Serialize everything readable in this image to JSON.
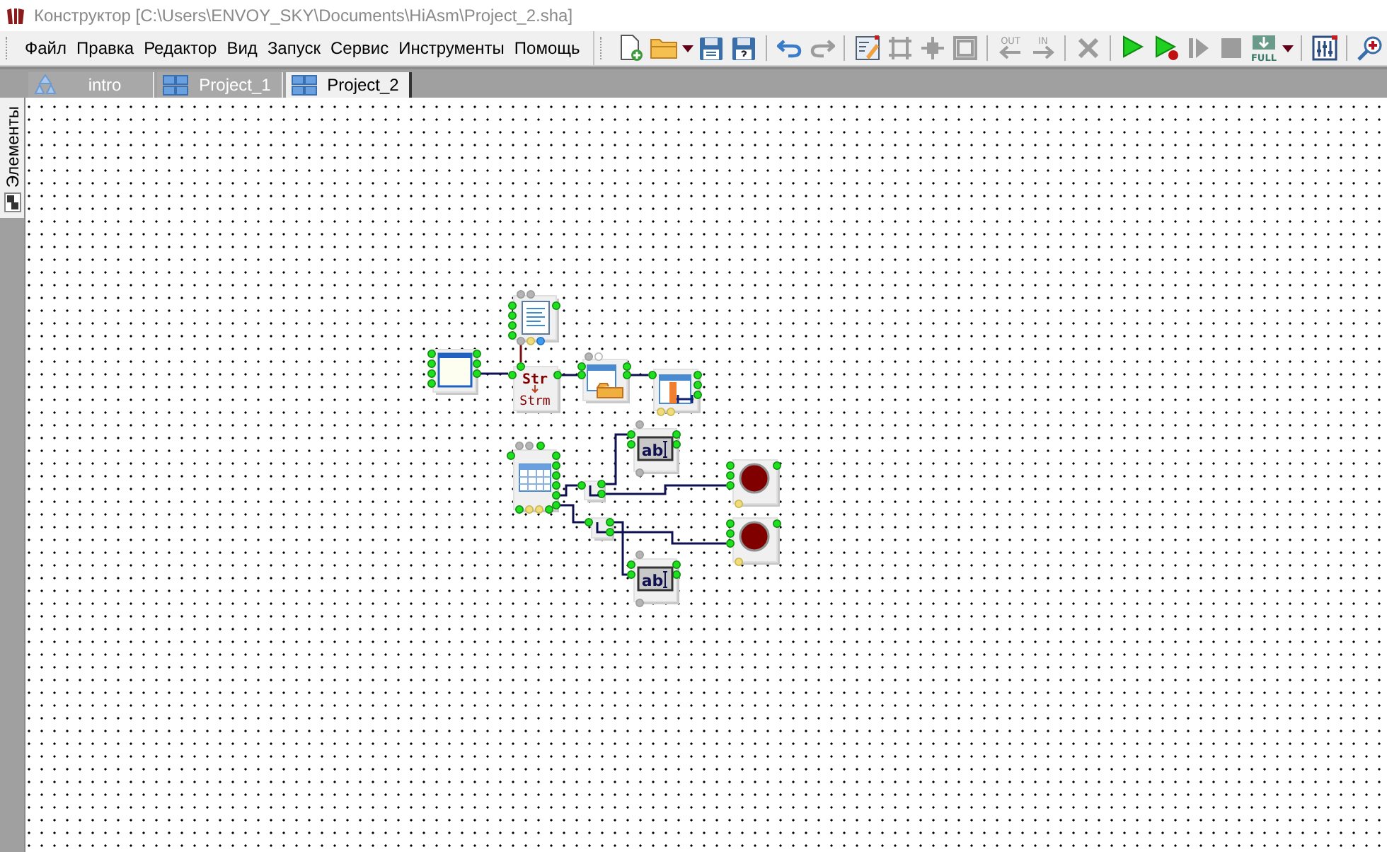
{
  "window": {
    "title": "Конструктор [C:\\Users\\ENVOY_SKY\\Documents\\HiAsm\\Project_2.sha]"
  },
  "menu": [
    "Файл",
    "Правка",
    "Редактор",
    "Вид",
    "Запуск",
    "Сервис",
    "Инструменты",
    "Помощь"
  ],
  "toolbar": [
    {
      "kind": "new",
      "disabled": false
    },
    {
      "kind": "open",
      "disabled": false
    },
    {
      "kind": "caret",
      "disabled": false
    },
    {
      "kind": "save",
      "disabled": false
    },
    {
      "kind": "save-as",
      "disabled": false
    },
    {
      "kind": "sep"
    },
    {
      "kind": "undo",
      "disabled": false
    },
    {
      "kind": "redo",
      "disabled": true
    },
    {
      "kind": "sep"
    },
    {
      "kind": "edit",
      "disabled": false
    },
    {
      "kind": "frame",
      "disabled": true
    },
    {
      "kind": "cross",
      "disabled": true
    },
    {
      "kind": "square",
      "disabled": true
    },
    {
      "kind": "sep"
    },
    {
      "kind": "out",
      "label": "OUT",
      "disabled": true
    },
    {
      "kind": "in",
      "label": "IN",
      "disabled": true
    },
    {
      "kind": "sep"
    },
    {
      "kind": "delete",
      "disabled": true
    },
    {
      "kind": "sep"
    },
    {
      "kind": "run",
      "disabled": false
    },
    {
      "kind": "run-debug",
      "disabled": false
    },
    {
      "kind": "step",
      "disabled": true
    },
    {
      "kind": "stop",
      "disabled": true
    },
    {
      "kind": "full",
      "label": "FULL",
      "disabled": false
    },
    {
      "kind": "caret",
      "disabled": false
    },
    {
      "kind": "sep"
    },
    {
      "kind": "mixer",
      "disabled": false
    },
    {
      "kind": "sep"
    },
    {
      "kind": "zoom",
      "disabled": false
    }
  ],
  "tabs": [
    {
      "label": "intro",
      "kind": "intro",
      "selected": false
    },
    {
      "label": "Project_1",
      "kind": "project",
      "selected": false
    },
    {
      "label": "Project_2",
      "kind": "project",
      "selected": true
    }
  ],
  "side_panel": {
    "label": "Элементы"
  },
  "diagram": {
    "nodes": [
      {
        "kind": "form"
      },
      {
        "kind": "memo"
      },
      {
        "kind": "str-to-stream",
        "labels": [
          "Str",
          "Strm"
        ]
      },
      {
        "kind": "open-dialog"
      },
      {
        "kind": "table-list"
      },
      {
        "kind": "grid"
      },
      {
        "kind": "splitter"
      },
      {
        "kind": "splitter"
      },
      {
        "kind": "edit",
        "labels": [
          "ab"
        ]
      },
      {
        "kind": "edit",
        "labels": [
          "ab"
        ]
      },
      {
        "kind": "led"
      },
      {
        "kind": "led"
      }
    ]
  }
}
